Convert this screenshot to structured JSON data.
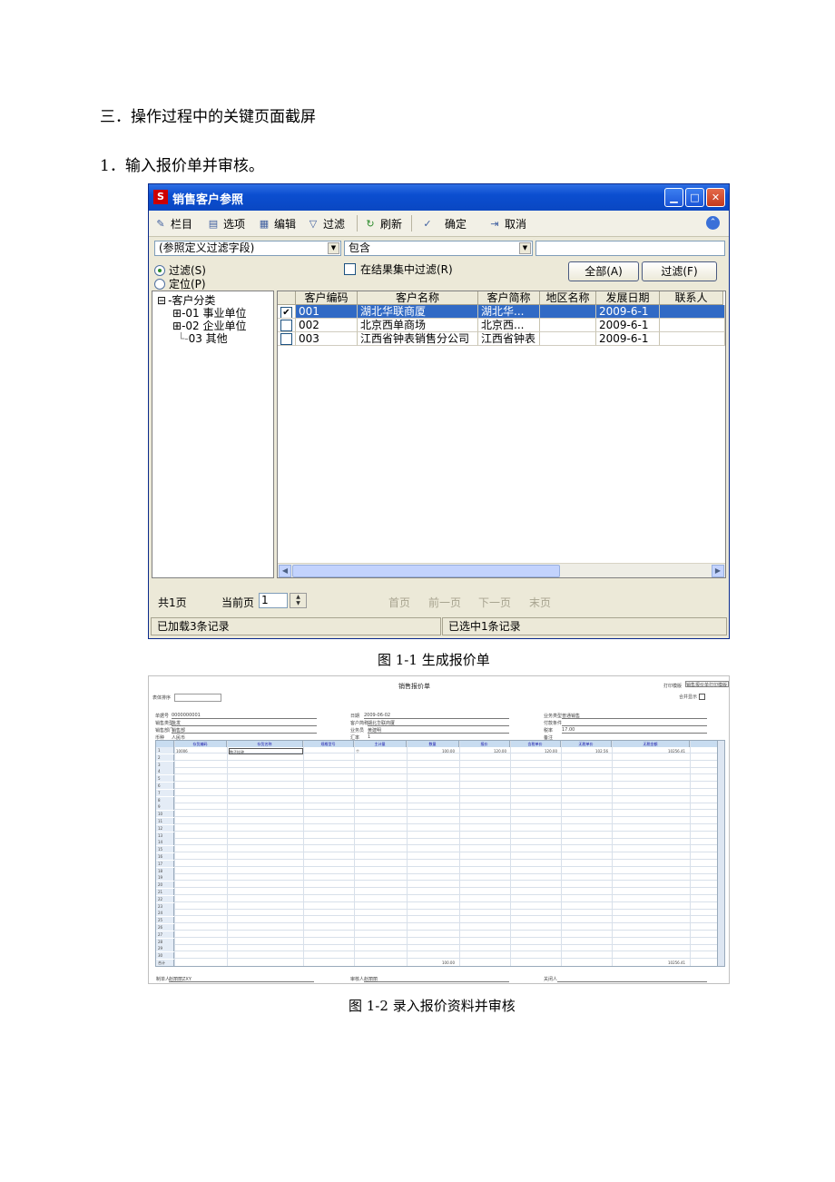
{
  "document": {
    "section_heading": "三．操作过程中的关键页面截屏",
    "item_heading": "1．输入报价单并审核。",
    "figure1_caption": "图 1-1    生成报价单",
    "figure2_caption": "图 1-2    录入报价资料并审核"
  },
  "window1": {
    "title": "销售客户参照",
    "logo": "S",
    "toolbar": {
      "columns": "栏目",
      "options": "选项",
      "edit": "编辑",
      "filter": "过滤",
      "refresh": "刷新",
      "confirm": "确定",
      "cancel": "取消"
    },
    "filter_bar": {
      "field_value": "(参照定义过滤字段)",
      "operator_value": "包含",
      "criteria_value": "",
      "radio_filter": "过滤(S)",
      "radio_locate": "定位(P)",
      "radio_selected": "filter",
      "filter_in_results": "在结果集中过滤(R)",
      "all_button": "全部(A)",
      "filter_button": "过滤(F)"
    },
    "tree": {
      "root": "客户分类",
      "children": [
        {
          "code": "01",
          "name": "事业单位"
        },
        {
          "code": "02",
          "name": "企业单位"
        },
        {
          "code": "03",
          "name": "其他"
        }
      ]
    },
    "grid": {
      "headers": [
        "",
        "客户编码",
        "客户名称",
        "客户简称",
        "地区名称",
        "发展日期",
        "联系人"
      ],
      "rows": [
        {
          "checked": true,
          "code": "001",
          "name": "湖北华联商厦",
          "short": "湖北华...",
          "region": "",
          "date": "2009-6-1",
          "contact": ""
        },
        {
          "checked": false,
          "code": "002",
          "name": "北京西单商场",
          "short": "北京西...",
          "region": "",
          "date": "2009-6-1",
          "contact": ""
        },
        {
          "checked": false,
          "code": "003",
          "name": "江西省钟表销售分公司",
          "short": "江西省钟表",
          "region": "",
          "date": "2009-6-1",
          "contact": ""
        }
      ]
    },
    "pager": {
      "total_pages": "共1页",
      "current_label": "当前页",
      "current_value": "1",
      "first": "首页",
      "prev": "前一页",
      "next": "下一页",
      "last": "末页"
    },
    "status": {
      "loaded": "已加载3条记录",
      "selected": "已选中1条记录"
    }
  },
  "window2": {
    "title": "销售报价单",
    "print_template_label": "打印模版",
    "print_template_value": "销售报价单打印模版",
    "merge_display": "合并显示",
    "form_label": "表体排序",
    "fields": {
      "doc_no_label": "单据号",
      "doc_no": "0000000001",
      "date_label": "日期",
      "date": "2009-06-02",
      "biz_type_label": "业务类型",
      "biz_type": "普通销售",
      "sale_type_label": "销售类型",
      "sale_type": "批发",
      "customer_label": "客户简称",
      "customer": "湖北华联商厦",
      "payment_label": "付款条件",
      "payment": "",
      "dept_label": "销售部门",
      "dept": "销售部",
      "salesman_label": "业务员",
      "salesman": "黄建明",
      "taxrate_label": "税率",
      "taxrate": "17.00",
      "currency_label": "币种",
      "currency": "人民币",
      "rate_label": "汇率",
      "rate": "1",
      "remark_label": "备注",
      "remark": ""
    },
    "grid_headers": [
      "存货编码",
      "存货名称",
      "规格型号",
      "主计量",
      "数量",
      "报价",
      "含税单价",
      "无税单价",
      "无税金额"
    ],
    "first_row": {
      "code": "10006",
      "name": "鸭子挂钟",
      "spec": "",
      "unit": "个",
      "qty": "100.00",
      "quote": "120.00",
      "taxprice": "120.00",
      "price": "102.56",
      "amount": "10256.41"
    },
    "row_numbers": [
      "1",
      "2",
      "3",
      "4",
      "5",
      "6",
      "7",
      "8",
      "9",
      "10",
      "11",
      "12",
      "13",
      "14",
      "15",
      "16",
      "17",
      "18",
      "19",
      "20",
      "21",
      "22",
      "23",
      "24",
      "25",
      "26",
      "27",
      "28",
      "29",
      "30"
    ],
    "total_label": "合计",
    "total_qty": "100.00",
    "total_amount": "10256.41",
    "footer": {
      "maker_label": "制单人",
      "maker": "赵丽丽ZXY",
      "auditor_label": "审核人",
      "auditor": "赵丽丽",
      "closer_label": "关闭人",
      "closer": ""
    }
  }
}
